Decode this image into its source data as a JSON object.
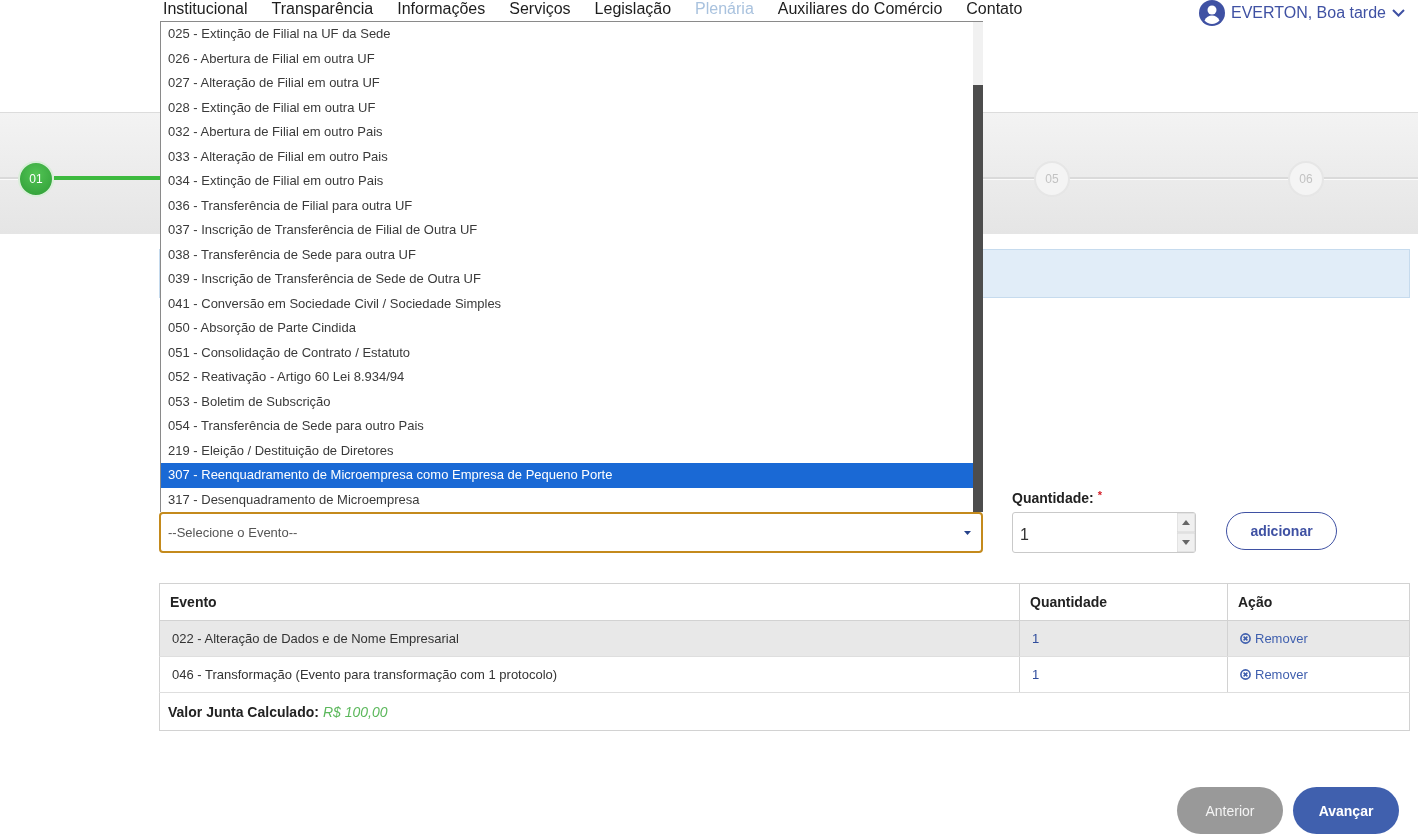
{
  "nav": {
    "items": [
      {
        "label": "Institucional",
        "selected": false
      },
      {
        "label": "Transparência",
        "selected": false
      },
      {
        "label": "Informações",
        "selected": false
      },
      {
        "label": "Serviços",
        "selected": false
      },
      {
        "label": "Legislação",
        "selected": false
      },
      {
        "label": "Plenária",
        "selected": true
      },
      {
        "label": "Auxiliares do Comércio",
        "selected": false
      },
      {
        "label": "Contato",
        "selected": false
      }
    ],
    "user_menu": {
      "label": "EVERTON, Boa tarde"
    }
  },
  "stepper": {
    "steps": [
      {
        "label": "01",
        "active": true
      },
      {
        "label": "05",
        "active": false
      },
      {
        "label": "06",
        "active": false
      }
    ]
  },
  "event_form": {
    "event_select": {
      "placeholder": "--Selecione o Evento--",
      "expanded": true,
      "options": [
        {
          "label": "025 - Extinção de Filial na UF da Sede",
          "selected": false
        },
        {
          "label": "026 - Abertura de Filial em outra UF",
          "selected": false
        },
        {
          "label": "027 - Alteração de Filial em outra UF",
          "selected": false
        },
        {
          "label": "028 - Extinção de Filial em outra UF",
          "selected": false
        },
        {
          "label": "032 - Abertura de Filial em outro Pais",
          "selected": false
        },
        {
          "label": "033 - Alteração de Filial em outro Pais",
          "selected": false
        },
        {
          "label": "034 - Extinção de Filial em outro Pais",
          "selected": false
        },
        {
          "label": "036 - Transferência de Filial para outra UF",
          "selected": false
        },
        {
          "label": "037 - Inscrição de Transferência de Filial de Outra UF",
          "selected": false
        },
        {
          "label": "038 - Transferência de Sede para outra UF",
          "selected": false
        },
        {
          "label": "039 - Inscrição de Transferência de Sede de Outra UF",
          "selected": false
        },
        {
          "label": "041 - Conversão em Sociedade Civil / Sociedade Simples",
          "selected": false
        },
        {
          "label": "050 - Absorção de Parte Cindida",
          "selected": false
        },
        {
          "label": "051 - Consolidação de Contrato / Estatuto",
          "selected": false
        },
        {
          "label": "052 - Reativação - Artigo 60 Lei 8.934/94",
          "selected": false
        },
        {
          "label": "053 - Boletim de Subscrição",
          "selected": false
        },
        {
          "label": "054 - Transferência de Sede para outro Pais",
          "selected": false
        },
        {
          "label": "219 - Eleição / Destituição de Diretores",
          "selected": false
        },
        {
          "label": "307 - Reenquadramento de Microempresa como Empresa de Pequeno Porte",
          "selected": true
        },
        {
          "label": "317 - Desenquadramento de Microempresa",
          "selected": false
        }
      ]
    },
    "quantity": {
      "label": "Quantidade:",
      "required_mark": "*",
      "value": "1"
    },
    "add_button": "adicionar"
  },
  "events_table": {
    "columns": [
      "Evento",
      "Quantidade",
      "Ação"
    ],
    "rows": [
      {
        "event": "022 - Alteração de Dados e de Nome Empresarial",
        "quantity": "1",
        "action": "Remover"
      },
      {
        "event": "046 - Transformação (Evento para transformação com 1 protocolo)",
        "quantity": "1",
        "action": "Remover"
      }
    ],
    "footer": {
      "label": "Valor Junta Calculado:",
      "value": "R$ 100,00"
    }
  },
  "buttons": [
    {
      "label": "Anterior",
      "kind": "secondary"
    },
    {
      "label": "Avançar",
      "kind": "primary"
    }
  ]
}
